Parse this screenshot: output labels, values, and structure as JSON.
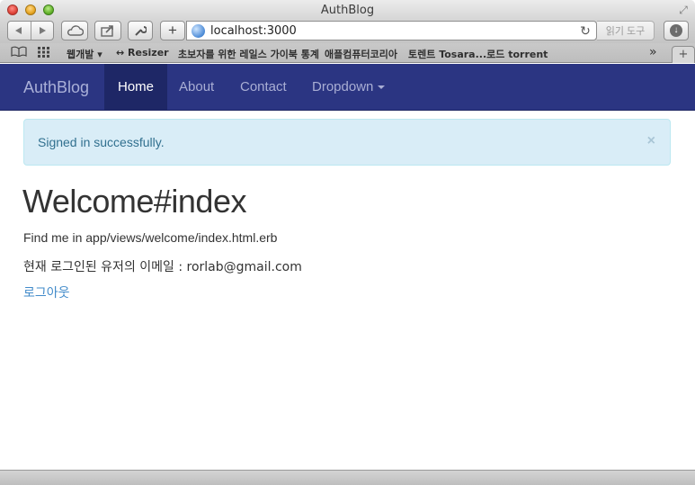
{
  "window": {
    "title": "AuthBlog"
  },
  "toolbar": {
    "url": "localhost:3000",
    "reader_label": "읽기 도구"
  },
  "bookmarks": {
    "items": [
      {
        "label": "웹개발 ▾"
      },
      {
        "label": "↔ Resizer"
      },
      {
        "label": "초보자를 위한 레일스 가이북 통계"
      },
      {
        "label": "애플컴퓨터코리아"
      },
      {
        "label": "토렌트 Tosara...로드 torrent"
      }
    ]
  },
  "navbar": {
    "brand": "AuthBlog",
    "items": [
      {
        "label": "Home",
        "active": true
      },
      {
        "label": "About"
      },
      {
        "label": "Contact"
      },
      {
        "label": "Dropdown"
      }
    ]
  },
  "alert": {
    "text": "Signed in successfully.",
    "close": "×"
  },
  "main": {
    "heading": "Welcome#index",
    "path_text": "Find me in app/views/welcome/index.html.erb",
    "email_text": "현재 로그인된 유저의 이메일 : rorlab@gmail.com",
    "logout_link": "로그아웃"
  },
  "colors": {
    "navbar_bg": "#2b3582",
    "alert_bg": "#d9edf7",
    "link": "#428bca"
  }
}
